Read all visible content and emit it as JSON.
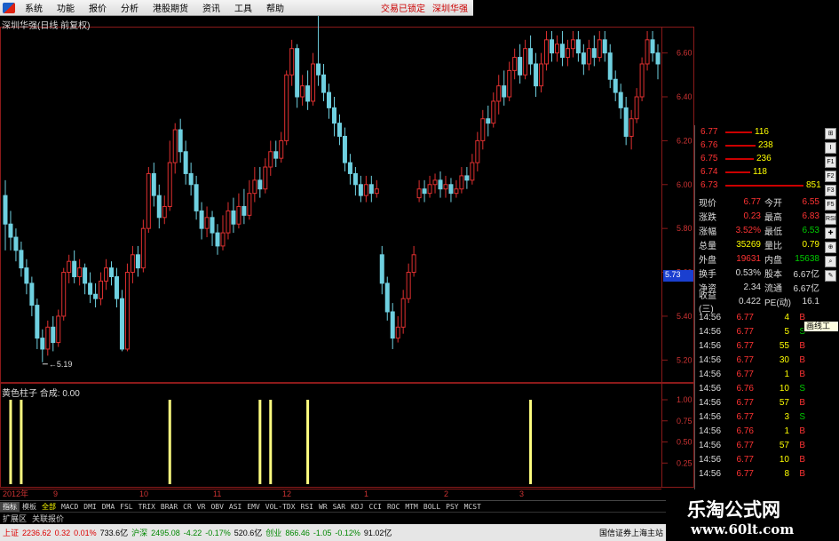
{
  "menu": {
    "items": [
      "系统",
      "功能",
      "报价",
      "分析",
      "港股期货",
      "资讯",
      "工具",
      "帮助"
    ],
    "right": [
      "交易已锁定",
      "深圳华强"
    ]
  },
  "chart_title": "深圳华强(日线 前复权)",
  "indicator_title": "黄色柱子   合成: 0.00",
  "price_marker": "5.73",
  "low_label": "5.19",
  "colors": {
    "up": "#e03030",
    "down": "#6fd0e0",
    "indicator": "#ffff80",
    "grid": "#8b1a1a",
    "axis_text": "#c33"
  },
  "chart_data": {
    "type": "candlestick",
    "price_ticks": [
      "6.60",
      "6.40",
      "6.20",
      "6.00",
      "5.80",
      "5.60",
      "5.40",
      "5.20"
    ],
    "ind_ticks": [
      "1.00",
      "0.75",
      "0.50",
      "0.25"
    ],
    "x_labels": [
      "2012年",
      "9",
      "10",
      "11",
      "12",
      "1",
      "2",
      "3"
    ],
    "low_marked": 5.19,
    "candles": [
      [
        5.95,
        5.82,
        6.02,
        5.7
      ],
      [
        5.82,
        5.76,
        5.88,
        5.7
      ],
      [
        5.76,
        5.7,
        5.8,
        5.65
      ],
      [
        5.7,
        5.62,
        5.74,
        5.58
      ],
      [
        5.62,
        5.55,
        5.66,
        5.5
      ],
      [
        5.55,
        5.45,
        5.58,
        5.4
      ],
      [
        5.45,
        5.3,
        5.48,
        5.25
      ],
      [
        5.3,
        5.25,
        5.34,
        5.19
      ],
      [
        5.25,
        5.35,
        5.38,
        5.22
      ],
      [
        5.35,
        5.28,
        5.4,
        5.24
      ],
      [
        5.28,
        5.4,
        5.43,
        5.26
      ],
      [
        5.4,
        5.6,
        5.62,
        5.38
      ],
      [
        5.6,
        5.65,
        5.68,
        5.55
      ],
      [
        5.65,
        5.58,
        5.7,
        5.55
      ],
      [
        5.58,
        5.62,
        5.66,
        5.54
      ],
      [
        5.62,
        5.55,
        5.64,
        5.5
      ],
      [
        5.55,
        5.5,
        5.6,
        5.46
      ],
      [
        5.5,
        5.48,
        5.55,
        5.44
      ],
      [
        5.48,
        5.56,
        5.6,
        5.45
      ],
      [
        5.56,
        5.62,
        5.66,
        5.52
      ],
      [
        5.62,
        5.58,
        5.65,
        5.54
      ],
      [
        5.58,
        5.48,
        5.62,
        5.44
      ],
      [
        5.48,
        5.25,
        5.52,
        5.24
      ],
      [
        5.25,
        5.6,
        5.64,
        5.24
      ],
      [
        5.6,
        5.68,
        5.72,
        5.55
      ],
      [
        5.68,
        5.62,
        5.72,
        5.58
      ],
      [
        5.62,
        5.8,
        5.84,
        5.6
      ],
      [
        5.8,
        6.05,
        6.08,
        5.78
      ],
      [
        6.05,
        5.95,
        6.1,
        5.9
      ],
      [
        5.95,
        5.85,
        6.0,
        5.8
      ],
      [
        5.85,
        5.9,
        5.95,
        5.82
      ],
      [
        5.9,
        6.1,
        6.2,
        5.88
      ],
      [
        6.1,
        6.25,
        6.28,
        6.05
      ],
      [
        6.25,
        6.15,
        6.3,
        6.1
      ],
      [
        6.15,
        6.05,
        6.2,
        6.0
      ],
      [
        6.05,
        6.0,
        6.1,
        5.95
      ],
      [
        6.0,
        5.88,
        6.04,
        5.84
      ],
      [
        5.88,
        5.8,
        5.92,
        5.75
      ],
      [
        5.8,
        5.85,
        5.9,
        5.76
      ],
      [
        5.85,
        5.78,
        5.88,
        5.72
      ],
      [
        5.78,
        5.72,
        5.82,
        5.68
      ],
      [
        5.72,
        5.78,
        5.86,
        5.7
      ],
      [
        5.78,
        5.88,
        5.92,
        5.75
      ],
      [
        5.88,
        5.82,
        5.94,
        5.78
      ],
      [
        5.82,
        5.9,
        5.96,
        5.8
      ],
      [
        5.9,
        5.86,
        5.98,
        5.82
      ],
      [
        5.86,
        5.96,
        6.02,
        5.84
      ],
      [
        5.96,
        6.02,
        6.08,
        5.92
      ],
      [
        6.02,
        5.98,
        6.08,
        5.94
      ],
      [
        5.98,
        6.08,
        6.12,
        5.96
      ],
      [
        6.08,
        6.15,
        6.2,
        6.04
      ],
      [
        6.15,
        6.12,
        6.2,
        6.08
      ],
      [
        6.12,
        6.2,
        6.24,
        6.1
      ],
      [
        6.2,
        6.5,
        6.52,
        6.18
      ],
      [
        6.5,
        6.62,
        6.66,
        6.45
      ],
      [
        6.62,
        6.4,
        6.64,
        6.35
      ],
      [
        6.4,
        6.45,
        6.5,
        6.36
      ],
      [
        6.45,
        6.38,
        6.52,
        6.34
      ],
      [
        6.38,
        6.55,
        6.6,
        6.36
      ],
      [
        6.55,
        6.5,
        6.88,
        6.45
      ],
      [
        6.5,
        6.42,
        6.55,
        6.38
      ],
      [
        6.42,
        6.35,
        6.46,
        6.3
      ],
      [
        6.35,
        6.28,
        6.4,
        6.22
      ],
      [
        6.28,
        6.22,
        6.32,
        6.18
      ],
      [
        6.22,
        6.1,
        6.26,
        6.06
      ],
      [
        6.1,
        6.05,
        6.14,
        6.0
      ],
      [
        6.05,
        6.0,
        6.08,
        5.95
      ],
      [
        6.0,
        5.95,
        6.04,
        5.92
      ],
      [
        5.95,
        6.0,
        6.04,
        5.92
      ],
      [
        6.0,
        5.96,
        6.04,
        5.92
      ],
      [
        5.96,
        5.98,
        6.02,
        5.94
      ],
      [
        5.68,
        5.55,
        5.72,
        5.5
      ],
      [
        5.55,
        5.42,
        5.58,
        5.38
      ],
      [
        5.42,
        5.3,
        5.46,
        5.25
      ],
      [
        5.3,
        5.35,
        5.4,
        5.28
      ],
      [
        5.35,
        5.48,
        5.52,
        5.32
      ],
      [
        5.48,
        5.6,
        5.64,
        5.46
      ],
      [
        5.6,
        5.68,
        5.72,
        5.58
      ],
      [
        5.94,
        5.98,
        6.02,
        5.92
      ],
      [
        5.98,
        5.96,
        6.02,
        5.92
      ],
      [
        5.96,
        6.0,
        6.04,
        5.94
      ],
      [
        6.0,
        6.02,
        6.05,
        5.96
      ],
      [
        6.02,
        5.98,
        6.06,
        5.94
      ],
      [
        5.98,
        6.0,
        6.04,
        5.94
      ],
      [
        6.0,
        5.96,
        6.03,
        5.92
      ],
      [
        5.96,
        5.98,
        6.02,
        5.94
      ],
      [
        5.98,
        6.04,
        6.08,
        5.96
      ],
      [
        6.04,
        6.02,
        6.08,
        5.98
      ],
      [
        6.02,
        6.1,
        6.14,
        6.0
      ],
      [
        6.1,
        6.2,
        6.24,
        6.06
      ],
      [
        6.2,
        6.3,
        6.34,
        6.16
      ],
      [
        6.3,
        6.28,
        6.36,
        6.22
      ],
      [
        6.28,
        6.38,
        6.42,
        6.26
      ],
      [
        6.38,
        6.45,
        6.5,
        6.32
      ],
      [
        6.45,
        6.4,
        6.52,
        6.36
      ],
      [
        6.4,
        6.52,
        6.56,
        6.38
      ],
      [
        6.52,
        6.58,
        6.62,
        6.48
      ],
      [
        6.58,
        6.5,
        6.64,
        6.46
      ],
      [
        6.5,
        6.62,
        6.66,
        6.48
      ],
      [
        6.62,
        6.55,
        6.68,
        6.5
      ],
      [
        6.55,
        6.45,
        6.6,
        6.4
      ],
      [
        6.45,
        6.55,
        6.6,
        6.42
      ],
      [
        6.55,
        6.66,
        6.7,
        6.52
      ],
      [
        6.66,
        6.6,
        6.7,
        6.56
      ],
      [
        6.6,
        6.64,
        6.68,
        6.56
      ],
      [
        6.64,
        6.58,
        6.7,
        6.54
      ],
      [
        6.58,
        6.62,
        6.66,
        6.54
      ],
      [
        6.62,
        6.66,
        6.7,
        6.58
      ],
      [
        6.66,
        6.6,
        6.7,
        6.56
      ],
      [
        6.6,
        6.55,
        6.64,
        6.5
      ],
      [
        6.55,
        6.62,
        6.66,
        6.52
      ],
      [
        6.62,
        6.58,
        6.68,
        6.54
      ],
      [
        6.58,
        6.66,
        6.7,
        6.56
      ],
      [
        6.66,
        6.6,
        6.7,
        6.56
      ],
      [
        6.6,
        6.48,
        6.64,
        6.44
      ],
      [
        6.48,
        6.42,
        6.52,
        6.38
      ],
      [
        6.42,
        6.35,
        6.46,
        6.3
      ],
      [
        6.35,
        6.22,
        6.4,
        6.18
      ],
      [
        6.22,
        6.3,
        6.34,
        6.16
      ],
      [
        6.3,
        6.4,
        6.44,
        6.28
      ],
      [
        6.4,
        6.55,
        6.58,
        6.38
      ],
      [
        6.55,
        6.66,
        6.7,
        6.52
      ],
      [
        6.66,
        6.6,
        6.7,
        6.56
      ],
      [
        6.6,
        6.55,
        6.64,
        6.48
      ]
    ],
    "indicator_bars": [
      {
        "idx": 1,
        "value": 1.0
      },
      {
        "idx": 3,
        "value": 1.0
      },
      {
        "idx": 31,
        "value": 1.0
      },
      {
        "idx": 48,
        "value": 1.0
      },
      {
        "idx": 50,
        "value": 1.0
      },
      {
        "idx": 57,
        "value": 1.0
      },
      {
        "idx": 99,
        "value": 1.0
      }
    ]
  },
  "order_book": [
    {
      "price": "6.77",
      "vol": "116"
    },
    {
      "price": "6.76",
      "vol": "238"
    },
    {
      "price": "6.75",
      "vol": "236"
    },
    {
      "price": "6.74",
      "vol": "118"
    },
    {
      "price": "6.73",
      "vol": "851"
    }
  ],
  "stats": [
    {
      "l1": "现价",
      "v1": "6.77",
      "c1": "red",
      "l2": "今开",
      "v2": "6.55",
      "c2": "red"
    },
    {
      "l1": "涨跌",
      "v1": "0.23",
      "c1": "red",
      "l2": "最高",
      "v2": "6.83",
      "c2": "red"
    },
    {
      "l1": "涨幅",
      "v1": "3.52%",
      "c1": "red",
      "l2": "最低",
      "v2": "6.53",
      "c2": "grn"
    },
    {
      "l1": "总量",
      "v1": "35269",
      "c1": "yel",
      "l2": "量比",
      "v2": "0.79",
      "c2": "yel"
    },
    {
      "l1": "外盘",
      "v1": "19631",
      "c1": "red",
      "l2": "内盘",
      "v2": "15638",
      "c2": "grn"
    },
    {
      "l1": "换手",
      "v1": "0.53%",
      "c1": "wht",
      "l2": "股本",
      "v2": "6.67亿",
      "c2": "wht"
    },
    {
      "l1": "净资",
      "v1": "2.34",
      "c1": "wht",
      "l2": "流通",
      "v2": "6.67亿",
      "c2": "wht"
    },
    {
      "l1": "收益(三)",
      "v1": "0.422",
      "c1": "wht",
      "l2": "PE(动)",
      "v2": "16.1",
      "c2": "wht"
    }
  ],
  "ticks": [
    {
      "t": "14:56",
      "p": "6.77",
      "v": "4",
      "bs": "B",
      "c": "red"
    },
    {
      "t": "14:56",
      "p": "6.77",
      "v": "5",
      "bs": "S",
      "c": "grn"
    },
    {
      "t": "14:56",
      "p": "6.77",
      "v": "55",
      "bs": "B",
      "c": "red"
    },
    {
      "t": "14:56",
      "p": "6.77",
      "v": "30",
      "bs": "B",
      "c": "red"
    },
    {
      "t": "14:56",
      "p": "6.77",
      "v": "1",
      "bs": "B",
      "c": "red"
    },
    {
      "t": "14:56",
      "p": "6.76",
      "v": "10",
      "bs": "S",
      "c": "grn"
    },
    {
      "t": "14:56",
      "p": "6.77",
      "v": "57",
      "bs": "B",
      "c": "red"
    },
    {
      "t": "14:56",
      "p": "6.77",
      "v": "3",
      "bs": "S",
      "c": "grn"
    },
    {
      "t": "14:56",
      "p": "6.76",
      "v": "1",
      "bs": "B",
      "c": "red"
    },
    {
      "t": "14:56",
      "p": "6.77",
      "v": "57",
      "bs": "B",
      "c": "red"
    },
    {
      "t": "14:56",
      "p": "6.77",
      "v": "10",
      "bs": "B",
      "c": "red"
    },
    {
      "t": "14:56",
      "p": "6.77",
      "v": "8",
      "bs": "B",
      "c": "red"
    }
  ],
  "right_tools": [
    "⊞",
    "Ⅰ",
    "F1",
    "F2",
    "F3",
    "F5",
    "RSI",
    "✚",
    "⊕",
    "⌕",
    "✎"
  ],
  "tool_tip": "画线工具",
  "bottom_tabs": [
    "指标",
    "模板",
    "全部",
    "MACD",
    "DMI",
    "DMA",
    "FSL",
    "TRIX",
    "BRAR",
    "CR",
    "VR",
    "OBV",
    "ASI",
    "EMV",
    "VOL-TDX",
    "RSI",
    "WR",
    "SAR",
    "KDJ",
    "CCI",
    "ROC",
    "MTM",
    "BOLL",
    "PSY",
    "MCST"
  ],
  "row2": [
    "扩展区",
    "关联报价"
  ],
  "status": {
    "idx1_name": "上证",
    "idx1_val": "2236.62",
    "idx1_chg": "0.32",
    "idx1_pct": "0.01%",
    "idx1_amt": "733.6亿",
    "idx2_name": "沪深",
    "idx2_val": "2495.08",
    "idx2_chg": "-4.22",
    "idx2_pct": "-0.17%",
    "idx2_amt": "520.6亿",
    "idx3_name": "创业",
    "idx3_val": "866.46",
    "idx3_chg": "-1.05",
    "idx3_pct": "-0.12%",
    "idx3_amt": "91.02亿",
    "broker": "国信证券上海主站"
  },
  "watermark": {
    "line1": "乐淘公式网",
    "line2": "www.60lt.com"
  }
}
